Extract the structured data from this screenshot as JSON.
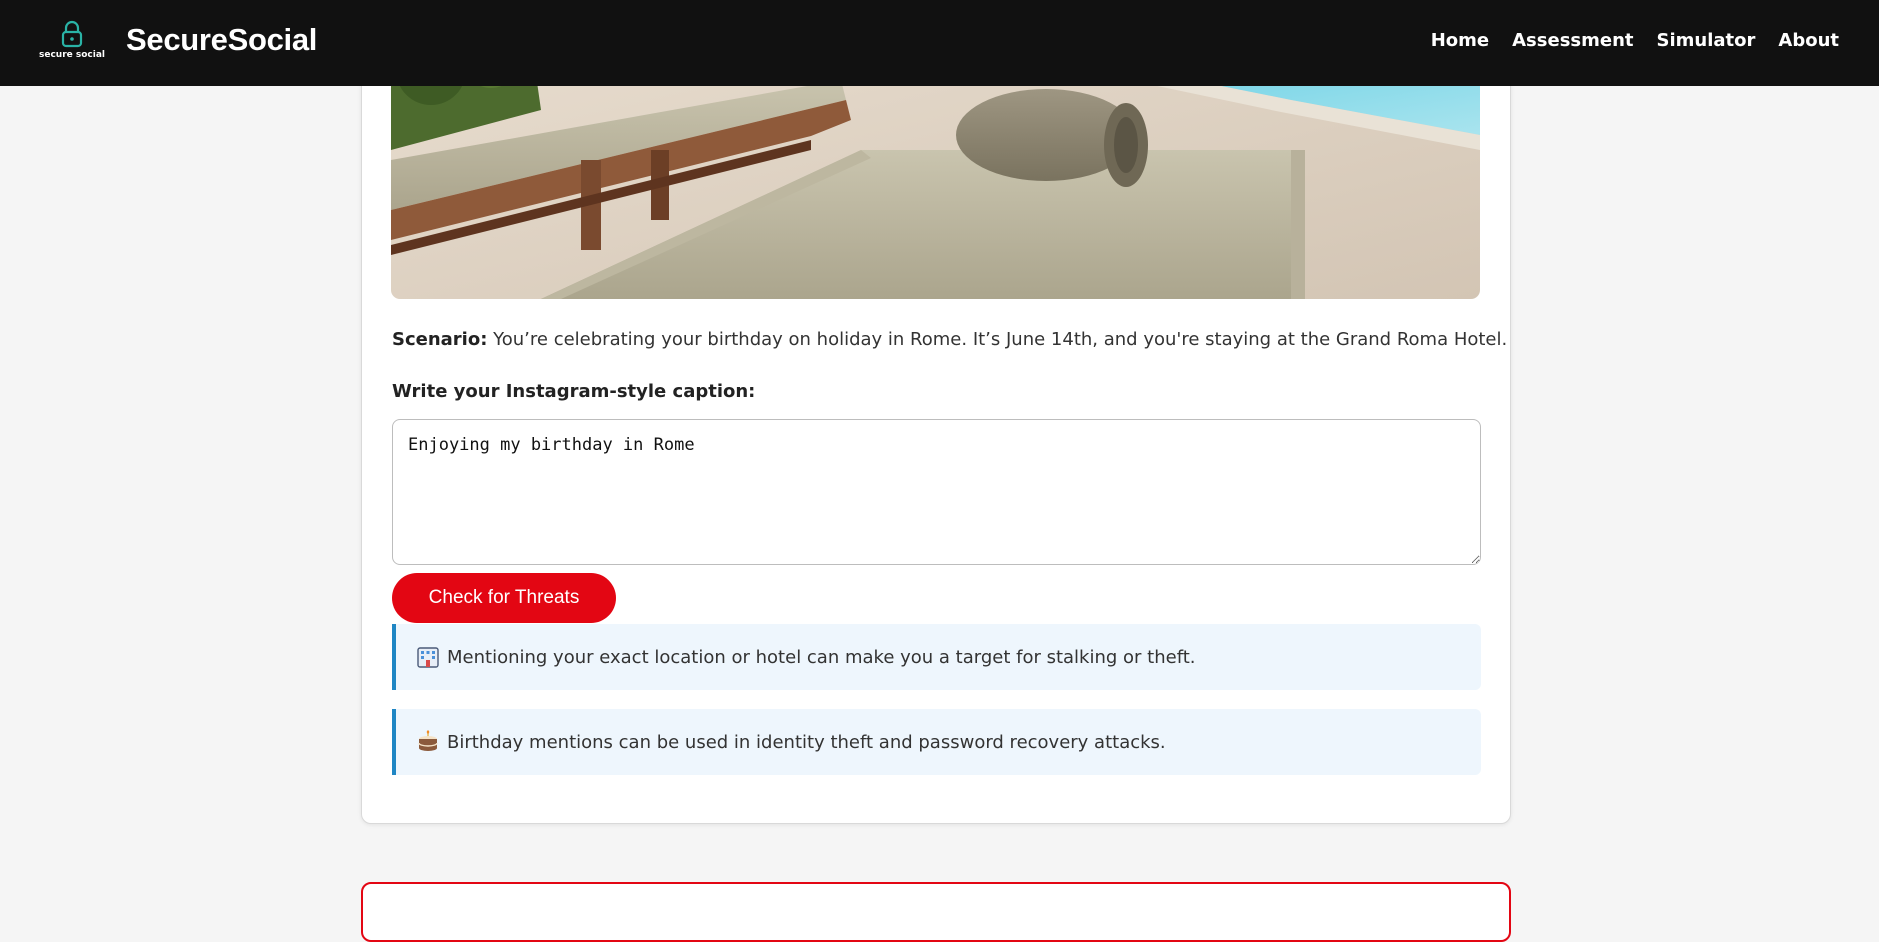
{
  "nav": {
    "logo_text": "secure social",
    "brand": "SecureSocial",
    "links": [
      "Home",
      "Assessment",
      "Simulator",
      "About"
    ]
  },
  "scenario": {
    "label": "Scenario:",
    "text": " You’re celebrating your birthday on holiday in Rome. It’s June 14th, and you're staying at the Grand Roma Hotel."
  },
  "caption": {
    "label": "Write your Instagram-style caption:",
    "value": "Enjoying my birthday in Rome"
  },
  "check_button": "Check for Threats",
  "alerts": [
    {
      "icon": "hotel-icon",
      "text": "Mentioning your exact location or hotel can make you a target for stalking or theft."
    },
    {
      "icon": "cake-icon",
      "text": "Birthday mentions can be used in identity theft and password recovery attacks."
    }
  ],
  "colors": {
    "navbar": "#111111",
    "accent_red": "#e30613",
    "alert_bg": "#eef6fd",
    "alert_border": "#1f86c4",
    "page_bg": "#f5f5f5"
  }
}
